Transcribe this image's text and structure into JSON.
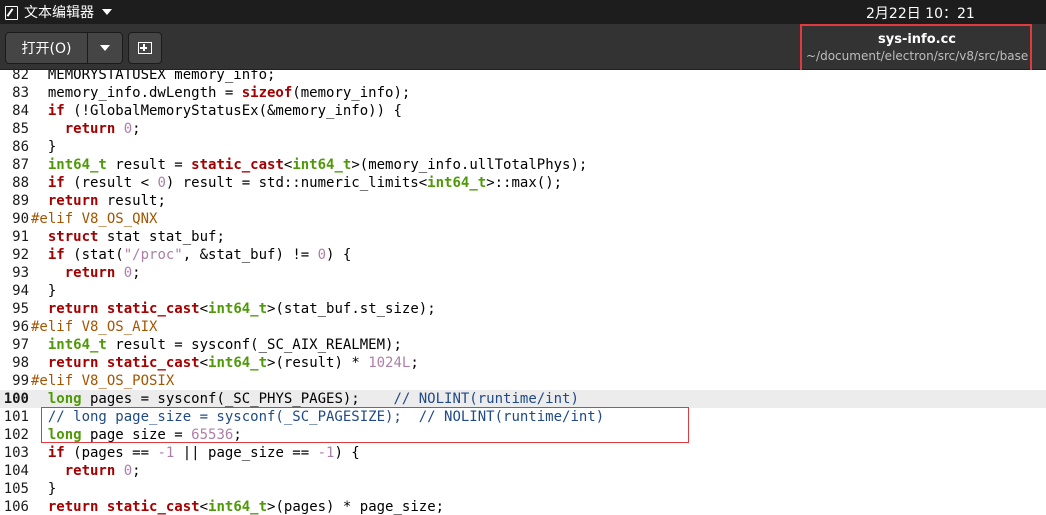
{
  "topbar": {
    "app_name": "文本编辑器",
    "clock": "2月22日  10：21"
  },
  "header": {
    "open_label": "打开(O)",
    "doc_title": "sys-info.cc",
    "doc_path": "~/document/electron/src/v8/src/base"
  },
  "editor": {
    "current_line": 100,
    "lines": [
      {
        "num": "82",
        "tokens": [
          [
            "",
            "  MEMORYSTATUSEX memory_info;"
          ]
        ]
      },
      {
        "num": "83",
        "tokens": [
          [
            "",
            "  memory_info.dwLength = "
          ],
          [
            "k",
            "sizeof"
          ],
          [
            "",
            "(memory_info);"
          ]
        ]
      },
      {
        "num": "84",
        "tokens": [
          [
            "",
            "  "
          ],
          [
            "k",
            "if"
          ],
          [
            "",
            " (!GlobalMemoryStatusEx(&memory_info)) {"
          ]
        ]
      },
      {
        "num": "85",
        "tokens": [
          [
            "",
            "    "
          ],
          [
            "k",
            "return"
          ],
          [
            "",
            " "
          ],
          [
            "n",
            "0"
          ],
          [
            "",
            ";"
          ]
        ]
      },
      {
        "num": "86",
        "tokens": [
          [
            "",
            "  }"
          ]
        ]
      },
      {
        "num": "87",
        "tokens": [
          [
            "",
            "  "
          ],
          [
            "t",
            "int64_t"
          ],
          [
            "",
            " result = "
          ],
          [
            "k",
            "static_cast"
          ],
          [
            "",
            "<"
          ],
          [
            "t",
            "int64_t"
          ],
          [
            "",
            ">(memory_info.ullTotalPhys);"
          ]
        ]
      },
      {
        "num": "88",
        "tokens": [
          [
            "",
            "  "
          ],
          [
            "k",
            "if"
          ],
          [
            "",
            " (result < "
          ],
          [
            "n",
            "0"
          ],
          [
            "",
            ") result = std::numeric_limits<"
          ],
          [
            "t",
            "int64_t"
          ],
          [
            "",
            ">::max();"
          ]
        ]
      },
      {
        "num": "89",
        "tokens": [
          [
            "",
            "  "
          ],
          [
            "k",
            "return"
          ],
          [
            "",
            " result;"
          ]
        ]
      },
      {
        "num": "90",
        "tokens": [
          [
            "p",
            "#elif V8_OS_QNX"
          ]
        ]
      },
      {
        "num": "91",
        "tokens": [
          [
            "",
            "  "
          ],
          [
            "k",
            "struct"
          ],
          [
            "",
            " stat stat_buf;"
          ]
        ]
      },
      {
        "num": "92",
        "tokens": [
          [
            "",
            "  "
          ],
          [
            "k",
            "if"
          ],
          [
            "",
            " (stat("
          ],
          [
            "s",
            "\"/proc\""
          ],
          [
            "",
            ", &stat_buf) != "
          ],
          [
            "n",
            "0"
          ],
          [
            "",
            ") {"
          ]
        ]
      },
      {
        "num": "93",
        "tokens": [
          [
            "",
            "    "
          ],
          [
            "k",
            "return"
          ],
          [
            "",
            " "
          ],
          [
            "n",
            "0"
          ],
          [
            "",
            ";"
          ]
        ]
      },
      {
        "num": "94",
        "tokens": [
          [
            "",
            "  }"
          ]
        ]
      },
      {
        "num": "95",
        "tokens": [
          [
            "",
            "  "
          ],
          [
            "k",
            "return"
          ],
          [
            "",
            " "
          ],
          [
            "k",
            "static_cast"
          ],
          [
            "",
            "<"
          ],
          [
            "t",
            "int64_t"
          ],
          [
            "",
            ">(stat_buf.st_size);"
          ]
        ]
      },
      {
        "num": "96",
        "tokens": [
          [
            "p",
            "#elif V8_OS_AIX"
          ]
        ]
      },
      {
        "num": "97",
        "tokens": [
          [
            "",
            "  "
          ],
          [
            "t",
            "int64_t"
          ],
          [
            "",
            " result = sysconf(_SC_AIX_REALMEM);"
          ]
        ]
      },
      {
        "num": "98",
        "tokens": [
          [
            "",
            "  "
          ],
          [
            "k",
            "return"
          ],
          [
            "",
            " "
          ],
          [
            "k",
            "static_cast"
          ],
          [
            "",
            "<"
          ],
          [
            "t",
            "int64_t"
          ],
          [
            "",
            ">(result) * "
          ],
          [
            "n",
            "1024L"
          ],
          [
            "",
            ";"
          ]
        ]
      },
      {
        "num": "99",
        "tokens": [
          [
            "p",
            "#elif V8_OS_POSIX"
          ]
        ]
      },
      {
        "num": "100",
        "tokens": [
          [
            "",
            "  "
          ],
          [
            "t",
            "long"
          ],
          [
            "",
            " pages = sysconf(_SC_PHYS_PAGES);    "
          ],
          [
            "c",
            "// NOLINT(runtime/int)"
          ]
        ]
      },
      {
        "num": "101",
        "tokens": [
          [
            "",
            "  "
          ],
          [
            "c",
            "// long page_size = sysconf(_SC_PAGESIZE);  // NOLINT(runtime/int)"
          ]
        ]
      },
      {
        "num": "102",
        "tokens": [
          [
            "",
            "  "
          ],
          [
            "t",
            "long"
          ],
          [
            "",
            " page_size = "
          ],
          [
            "n",
            "65536"
          ],
          [
            "",
            ";"
          ]
        ]
      },
      {
        "num": "103",
        "tokens": [
          [
            "",
            "  "
          ],
          [
            "k",
            "if"
          ],
          [
            "",
            " (pages == "
          ],
          [
            "n",
            "-1"
          ],
          [
            "",
            " || page_size == "
          ],
          [
            "n",
            "-1"
          ],
          [
            "",
            ") {"
          ]
        ]
      },
      {
        "num": "104",
        "tokens": [
          [
            "",
            "    "
          ],
          [
            "k",
            "return"
          ],
          [
            "",
            " "
          ],
          [
            "n",
            "0"
          ],
          [
            "",
            ";"
          ]
        ]
      },
      {
        "num": "105",
        "tokens": [
          [
            "",
            "  }"
          ]
        ]
      },
      {
        "num": "106",
        "tokens": [
          [
            "",
            "  "
          ],
          [
            "k",
            "return"
          ],
          [
            "",
            " "
          ],
          [
            "k",
            "static_cast"
          ],
          [
            "",
            "<"
          ],
          [
            "t",
            "int64_t"
          ],
          [
            "",
            ">(pages) * page_size;"
          ]
        ]
      }
    ]
  },
  "colors": {
    "keyword": "#a40000",
    "type": "#4e9a06",
    "number": "#ad7fa8",
    "comment": "#204a87",
    "preprocessor": "#a45500",
    "annotation": "#e0393e"
  }
}
